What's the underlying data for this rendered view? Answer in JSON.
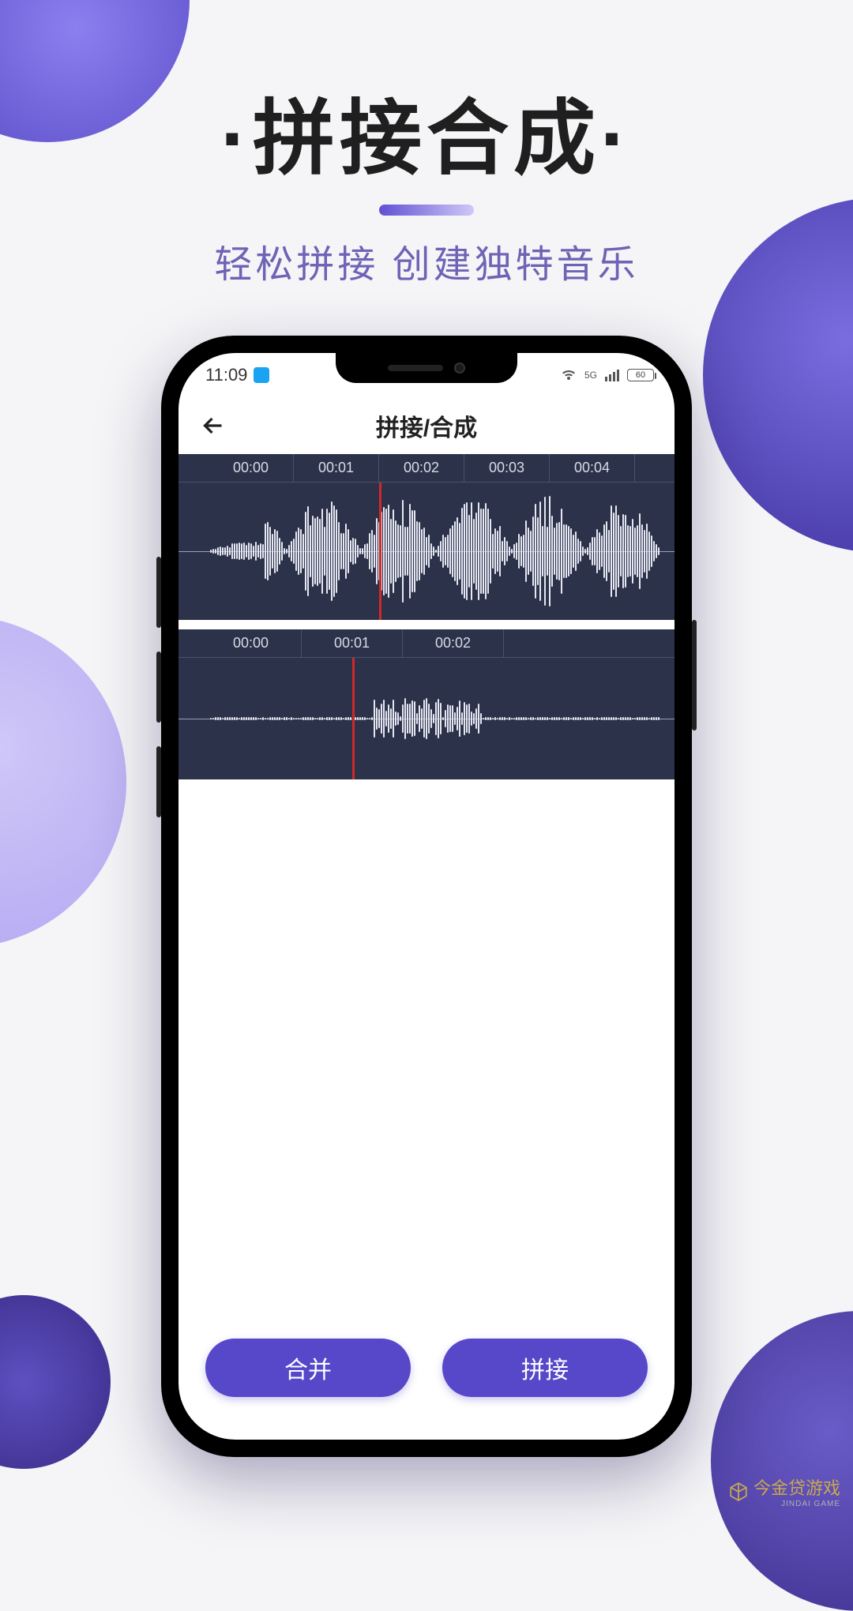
{
  "promo": {
    "title": "拼接合成",
    "subtitle": "轻松拼接 创建独特音乐"
  },
  "status": {
    "time": "11:09",
    "network": "5G",
    "battery": "60"
  },
  "nav": {
    "title": "拼接/合成"
  },
  "tracks": [
    {
      "ruler": [
        "00:00",
        "00:01",
        "00:02",
        "00:03",
        "00:04"
      ]
    },
    {
      "ruler": [
        "00:00",
        "00:01",
        "00:02"
      ]
    }
  ],
  "buttons": {
    "merge": "合并",
    "concat": "拼接"
  },
  "watermark": {
    "brand": "今金贷游戏",
    "sub": "JINDAI GAME"
  }
}
